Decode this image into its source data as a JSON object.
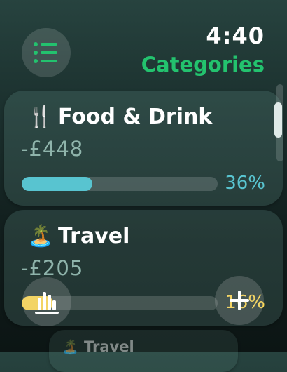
{
  "status": {
    "time": "4:40"
  },
  "header": {
    "title": "Categories",
    "menu_icon": "list-icon"
  },
  "colors": {
    "title": "#23c26e",
    "food_bar": "#58c4d0",
    "travel_bar": "#ffd84a"
  },
  "categories": [
    {
      "icon": "🍴",
      "icon_name": "fork-knife-icon",
      "name": "Food & Drink",
      "amount": "-£448",
      "percent_label": "36%",
      "progress": 0.36
    },
    {
      "icon": "🏝️",
      "icon_name": "island-icon",
      "name": "Travel",
      "amount": "-£205",
      "percent_label": "16%",
      "progress": 0.16
    },
    {
      "icon": "🏝️",
      "icon_name": "island-icon",
      "name": "Travel"
    }
  ],
  "actions": {
    "chart_icon": "bar-chart-icon",
    "add_icon": "plus-icon"
  }
}
